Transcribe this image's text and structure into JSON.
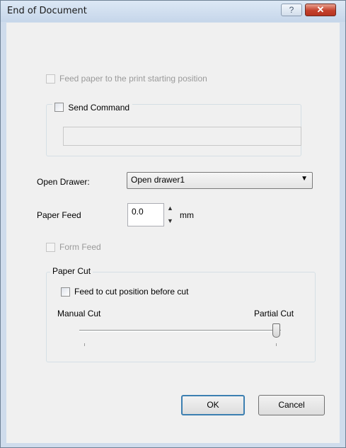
{
  "window": {
    "title": "End of Document",
    "help_label": "?",
    "close_label": "✕"
  },
  "feed_start": {
    "label": "Feed paper to the print starting position",
    "checked": false,
    "enabled": false
  },
  "send_command": {
    "label": "Send Command",
    "checked": false,
    "value": ""
  },
  "open_drawer": {
    "label": "Open Drawer:",
    "selected": "Open drawer1",
    "arrow": "▼"
  },
  "paper_feed": {
    "label": "Paper Feed",
    "value": "0.0",
    "unit": "mm",
    "up": "▲",
    "down": "▼"
  },
  "form_feed": {
    "label": "Form Feed",
    "checked": false,
    "enabled": false
  },
  "paper_cut": {
    "legend": "Paper Cut",
    "feed_before_cut_label": "Feed to cut position before cut",
    "feed_before_cut_checked": false,
    "slider_min_label": "Manual Cut",
    "slider_max_label": "Partial Cut",
    "slider_value": 1,
    "slider_max": 1
  },
  "buttons": {
    "ok": "OK",
    "cancel": "Cancel"
  },
  "colors": {
    "title_bar": "#c6d6ea",
    "close_button": "#c4412c",
    "default_button_border": "#3c7fb1",
    "dialog_face": "#f0f0f0"
  }
}
